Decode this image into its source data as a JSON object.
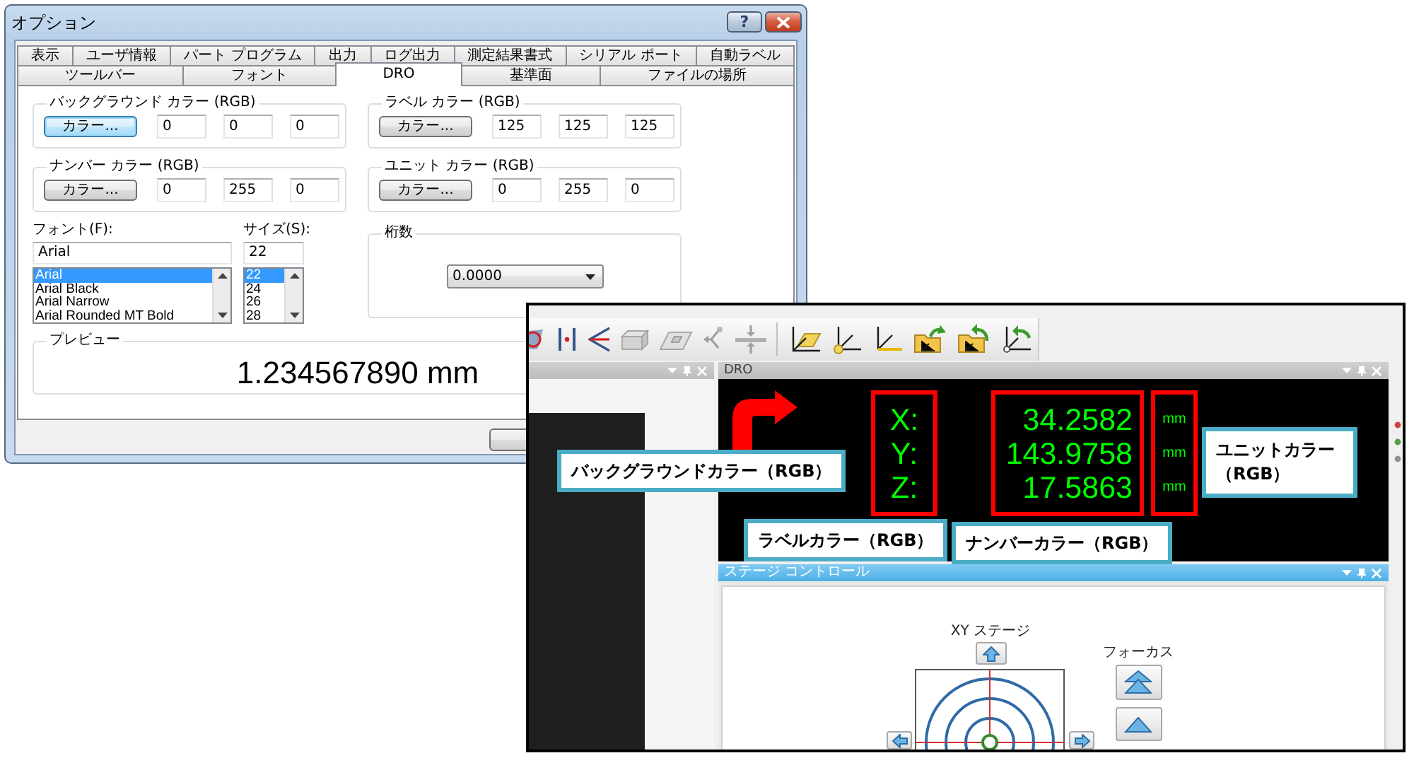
{
  "dialog": {
    "title": "オプション",
    "help_button": "?",
    "tab_rows": [
      {
        "tabs": [
          {
            "label": "表示",
            "selected": false
          },
          {
            "label": "ユーザ情報",
            "selected": false
          },
          {
            "label": "パート プログラム",
            "selected": false
          },
          {
            "label": "出力",
            "selected": false
          },
          {
            "label": "ログ出力",
            "selected": false
          },
          {
            "label": "測定結果書式",
            "selected": false
          },
          {
            "label": "シリアル ポート",
            "selected": false
          },
          {
            "label": "自動ラベル",
            "selected": false
          }
        ]
      },
      {
        "tabs": [
          {
            "label": "ツールバー",
            "selected": false
          },
          {
            "label": "フォント",
            "selected": false
          },
          {
            "label": "DRO",
            "selected": true
          },
          {
            "label": "基準面",
            "selected": false
          },
          {
            "label": "ファイルの場所",
            "selected": false
          }
        ]
      }
    ],
    "color_groups": [
      {
        "title": "バックグラウンド カラー (RGB)",
        "button": "カラー...",
        "focused": true,
        "values": [
          "0",
          "0",
          "0"
        ]
      },
      {
        "title": "ラベル カラー (RGB)",
        "button": "カラー...",
        "focused": false,
        "values": [
          "125",
          "125",
          "125"
        ]
      },
      {
        "title": "ナンバー カラー (RGB)",
        "button": "カラー...",
        "focused": false,
        "values": [
          "0",
          "255",
          "0"
        ]
      },
      {
        "title": "ユニット カラー (RGB)",
        "button": "カラー...",
        "focused": false,
        "values": [
          "0",
          "255",
          "0"
        ]
      }
    ],
    "font": {
      "label": "フォント(F):",
      "value": "Arial",
      "items": [
        {
          "label": "Arial",
          "selected": true
        },
        {
          "label": "Arial Black",
          "selected": false
        },
        {
          "label": "Arial Narrow",
          "selected": false
        },
        {
          "label": "Arial Rounded MT Bold",
          "selected": false
        }
      ]
    },
    "size": {
      "label": "サイズ(S):",
      "value": "22",
      "items": [
        {
          "label": "22",
          "selected": true
        },
        {
          "label": "24",
          "selected": false
        },
        {
          "label": "26",
          "selected": false
        },
        {
          "label": "28",
          "selected": false
        }
      ]
    },
    "digits": {
      "title": "桁数",
      "value": "0.0000"
    },
    "preview": {
      "title": "プレビュー",
      "text": "1.234567890 mm"
    }
  },
  "app_window": {
    "dro_panel": {
      "title": "DRO",
      "readings": [
        {
          "label": "X:",
          "value": "34.2582",
          "unit": "mm"
        },
        {
          "label": "Y:",
          "value": "143.9758",
          "unit": "mm"
        },
        {
          "label": "Z:",
          "value": "17.5863",
          "unit": "mm"
        }
      ]
    },
    "stage_panel": {
      "title": "ステージ コントロール",
      "xy_label": "XY ステージ",
      "focus_label": "フォーカス"
    }
  },
  "callouts": [
    {
      "text": "バックグラウンドカラー（RGB）"
    },
    {
      "text": "ユニットカラー（RGB）"
    },
    {
      "text": "ラベルカラー（RGB）"
    },
    {
      "text": "ナンバーカラー（RGB）"
    }
  ]
}
